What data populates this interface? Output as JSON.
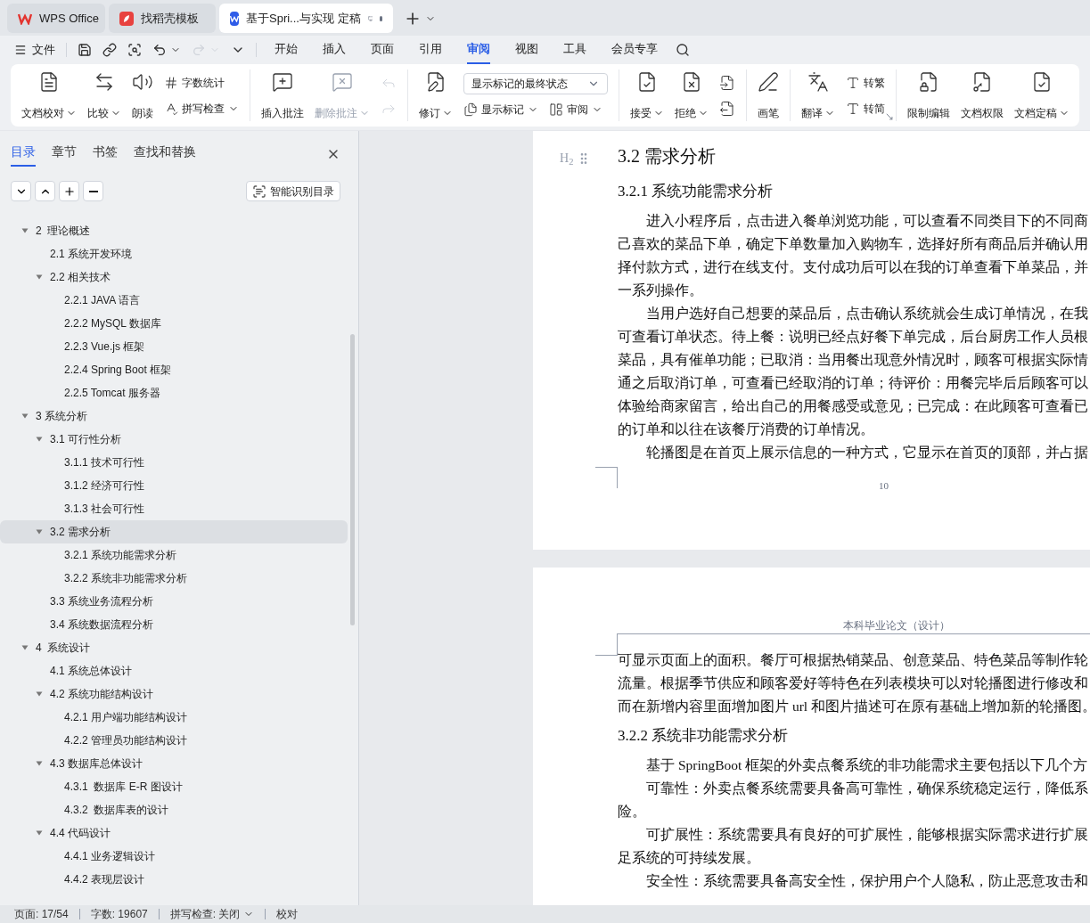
{
  "tabs": [
    {
      "kind": "wps",
      "label": "WPS Office",
      "selected": false
    },
    {
      "kind": "template",
      "label": "找稻壳模板",
      "selected": false
    },
    {
      "kind": "doc",
      "label": "基于Spri...与实现 定稿",
      "selected": true
    }
  ],
  "quick_menu": {
    "label": "文件"
  },
  "menu_tabs": [
    {
      "label": "开始",
      "selected": false
    },
    {
      "label": "插入",
      "selected": false
    },
    {
      "label": "页面",
      "selected": false
    },
    {
      "label": "引用",
      "selected": false
    },
    {
      "label": "审阅",
      "selected": true
    },
    {
      "label": "视图",
      "selected": false
    },
    {
      "label": "工具",
      "selected": false
    },
    {
      "label": "会员专享",
      "selected": false
    }
  ],
  "ribbon": [
    {
      "items": [
        {
          "kind": "large",
          "label": "文档校对",
          "dropdown": true,
          "disabled": false
        },
        {
          "kind": "large",
          "label": "比较",
          "dropdown": true,
          "disabled": false
        },
        {
          "kind": "large",
          "label": "朗读",
          "dropdown": false,
          "disabled": false
        },
        {
          "kind": "stack",
          "items": [
            {
              "label": "字数统计",
              "dropdown": false,
              "disabled": false
            },
            {
              "label": "拼写检查",
              "dropdown": true,
              "disabled": false
            }
          ]
        }
      ]
    },
    {
      "items": [
        {
          "kind": "large",
          "label": "插入批注",
          "dropdown": false,
          "disabled": false
        },
        {
          "kind": "large",
          "label": "删除批注",
          "dropdown": true,
          "disabled": true
        },
        {
          "kind": "stack",
          "items": [
            {
              "disabled": true
            },
            {
              "disabled": true
            }
          ]
        }
      ]
    },
    {
      "items": [
        {
          "kind": "large",
          "label": "修订",
          "dropdown": true,
          "disabled": false
        },
        {
          "kind": "select",
          "value": "显示标记的最终状态",
          "items": [
            {
              "label": "显示标记",
              "dropdown": true,
              "disabled": false
            },
            {
              "label": "审阅",
              "dropdown": true,
              "disabled": false
            }
          ]
        }
      ]
    },
    {
      "items": [
        {
          "kind": "large",
          "label": "接受",
          "dropdown": true,
          "disabled": false
        },
        {
          "kind": "large",
          "label": "拒绝",
          "dropdown": true,
          "disabled": false
        },
        {
          "kind": "stack",
          "items": [
            {
              "disabled": false
            },
            {
              "disabled": false
            }
          ]
        }
      ]
    },
    {
      "items": [
        {
          "kind": "large",
          "label": "画笔",
          "dropdown": false,
          "disabled": false
        }
      ]
    },
    {
      "items": [
        {
          "kind": "large",
          "label": "翻译",
          "dropdown": true,
          "disabled": false
        },
        {
          "kind": "stack",
          "items": [
            {
              "label": "转繁",
              "dropdown": false,
              "disabled": false
            },
            {
              "label": "转简",
              "dropdown": false,
              "disabled": false
            }
          ]
        }
      ]
    },
    {
      "items": [
        {
          "kind": "large",
          "label": "限制编辑",
          "dropdown": false,
          "disabled": false
        },
        {
          "kind": "large",
          "label": "文档权限",
          "dropdown": false,
          "disabled": false
        },
        {
          "kind": "large",
          "label": "文档定稿",
          "dropdown": true,
          "disabled": false
        }
      ]
    }
  ],
  "sidebar": {
    "tabs": [
      {
        "label": "目录",
        "selected": true
      },
      {
        "label": "章节",
        "selected": false
      },
      {
        "label": "书签",
        "selected": false
      },
      {
        "label": "查找和替换",
        "selected": false
      }
    ],
    "smart_button": "智能识别目录",
    "toc": [
      {
        "label": "2  理论概述",
        "selected": false,
        "expanded": true,
        "children": [
          {
            "label": "2.1 系统开发环境",
            "selected": false
          },
          {
            "label": "2.2 相关技术",
            "selected": false,
            "expanded": true,
            "children": [
              {
                "label": "2.2.1 JAVA 语言",
                "selected": false
              },
              {
                "label": "2.2.2 MySQL 数据库",
                "selected": false
              },
              {
                "label": "2.2.3 Vue.js 框架",
                "selected": false
              },
              {
                "label": "2.2.4 Spring Boot 框架",
                "selected": false
              },
              {
                "label": "2.2.5 Tomcat 服务器",
                "selected": false
              }
            ]
          }
        ]
      },
      {
        "label": "3 系统分析",
        "selected": false,
        "expanded": true,
        "children": [
          {
            "label": "3.1 可行性分析",
            "selected": false,
            "expanded": true,
            "children": [
              {
                "label": "3.1.1 技术可行性",
                "selected": false
              },
              {
                "label": "3.1.2 经济可行性",
                "selected": false
              },
              {
                "label": "3.1.3 社会可行性",
                "selected": false
              }
            ]
          },
          {
            "label": "3.2 需求分析",
            "selected": true,
            "expanded": true,
            "children": [
              {
                "label": "3.2.1 系统功能需求分析",
                "selected": false
              },
              {
                "label": "3.2.2 系统非功能需求分析",
                "selected": false
              }
            ]
          },
          {
            "label": "3.3 系统业务流程分析",
            "selected": false
          },
          {
            "label": "3.4 系统数据流程分析",
            "selected": false
          }
        ]
      },
      {
        "label": "4  系统设计",
        "selected": false,
        "expanded": true,
        "children": [
          {
            "label": "4.1 系统总体设计",
            "selected": false
          },
          {
            "label": "4.2 系统功能结构设计",
            "selected": false,
            "expanded": true,
            "children": [
              {
                "label": "4.2.1 用户端功能结构设计",
                "selected": false
              },
              {
                "label": "4.2.2 管理员功能结构设计",
                "selected": false
              }
            ]
          },
          {
            "label": "4.3 数据库总体设计",
            "selected": false,
            "expanded": true,
            "children": [
              {
                "label": "4.3.1  数据库 E-R 图设计",
                "selected": false
              },
              {
                "label": "4.3.2  数据库表的设计",
                "selected": false
              }
            ]
          },
          {
            "label": "4.4 代码设计",
            "selected": false,
            "expanded": true,
            "children": [
              {
                "label": "4.4.1 业务逻辑设计",
                "selected": false
              },
              {
                "label": "4.4.2 表现层设计",
                "selected": false
              }
            ]
          }
        ]
      }
    ]
  },
  "document": {
    "heading_marker": "H$_{2}$",
    "pages": [
      {
        "page_number": "10",
        "blocks": [
          {
            "kind": "heading2",
            "text": "3.2 需求分析"
          },
          {
            "kind": "heading3",
            "text": "3.2.1 系统功能需求分析"
          },
          {
            "kind": "line",
            "indent": true,
            "text": "进入小程序后，点击进入餐单浏览功能，可以查看不同类目下的不同商"
          },
          {
            "kind": "line",
            "indent": false,
            "text": "己喜欢的菜品下单，确定下单数量加入购物车，选择好所有商品后并确认用"
          },
          {
            "kind": "line",
            "indent": false,
            "text": "择付款方式，进行在线支付。支付成功后可以在我的订单查看下单菜品，并"
          },
          {
            "kind": "line",
            "indent": false,
            "text": "一系列操作。"
          },
          {
            "kind": "line",
            "indent": true,
            "text": "当用户选好自己想要的菜品后，点击确认系统就会生成订单情况，在我"
          },
          {
            "kind": "line",
            "indent": false,
            "text": "可查看订单状态。待上餐：说明已经点好餐下单完成，后台厨房工作人员根"
          },
          {
            "kind": "line",
            "indent": false,
            "text": "菜品，具有催单功能；已取消：当用餐出现意外情况时，顾客可根据实际情"
          },
          {
            "kind": "line",
            "indent": false,
            "text": "通之后取消订单，可查看已经取消的订单；待评价：用餐完毕后后顾客可以"
          },
          {
            "kind": "line",
            "indent": false,
            "text": "体验给商家留言，给出自己的用餐感受或意见；已完成：在此顾客可查看已"
          },
          {
            "kind": "line",
            "indent": false,
            "text": "的订单和以往在该餐厅消费的订单情况。"
          },
          {
            "kind": "line",
            "indent": true,
            "text": "轮播图是在首页上展示信息的一种方式，它显示在首页的顶部，并占据"
          }
        ]
      },
      {
        "header": "本科毕业论文（设计）",
        "blocks": [
          {
            "kind": "line",
            "indent": false,
            "text": "可显示页面上的面积。餐厅可根据热销菜品、创意菜品、特色菜品等制作轮"
          },
          {
            "kind": "line",
            "indent": false,
            "text": "流量。根据季节供应和顾客爱好等特色在列表模块可以对轮播图进行修改和"
          },
          {
            "kind": "line",
            "indent": false,
            "text": "而在新增内容里面增加图片 url 和图片描述可在原有基础上增加新的轮播图。"
          },
          {
            "kind": "heading3",
            "text": "3.2.2 系统非功能需求分析"
          },
          {
            "kind": "line",
            "indent": true,
            "text": "基于 SpringBoot 框架的外卖点餐系统的非功能需求主要包括以下几个方"
          },
          {
            "kind": "line",
            "indent": true,
            "text": "可靠性：外卖点餐系统需要具备高可靠性，确保系统稳定运行，降低系"
          },
          {
            "kind": "line",
            "indent": false,
            "text": "险。"
          },
          {
            "kind": "line",
            "indent": true,
            "text": "可扩展性：系统需要具有良好的可扩展性，能够根据实际需求进行扩展"
          },
          {
            "kind": "line",
            "indent": false,
            "text": "足系统的可持续发展。"
          },
          {
            "kind": "line",
            "indent": true,
            "text": "安全性：系统需要具备高安全性，保护用户个人隐私，防止恶意攻击和"
          }
        ]
      }
    ]
  },
  "status_bar": [
    {
      "kind": "text",
      "label": "页面: 17/54"
    },
    {
      "kind": "text",
      "label": "字数: 19607"
    },
    {
      "kind": "dropdown",
      "label": "拼写检查: 关闭"
    },
    {
      "kind": "text",
      "label": "校对"
    }
  ]
}
